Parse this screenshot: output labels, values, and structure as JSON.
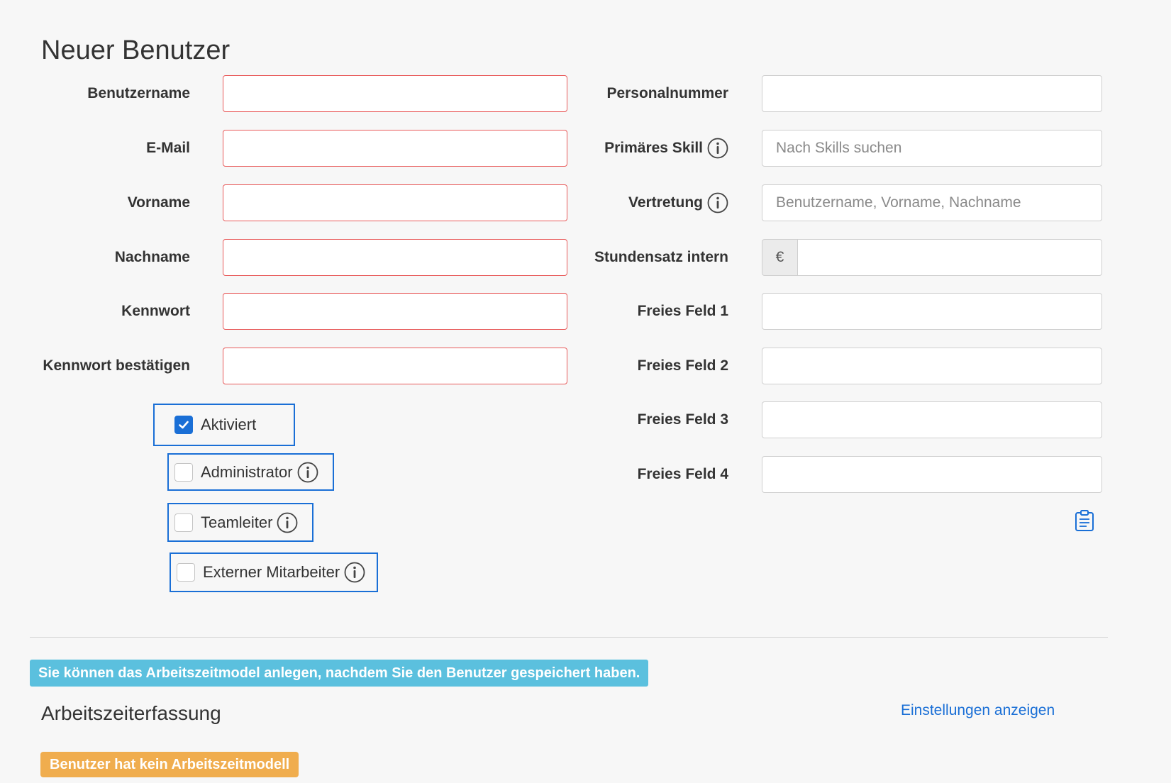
{
  "page": {
    "title": "Neuer Benutzer"
  },
  "left_form": {
    "username": {
      "label": "Benutzername",
      "value": ""
    },
    "email": {
      "label": "E-Mail",
      "value": ""
    },
    "firstname": {
      "label": "Vorname",
      "value": ""
    },
    "lastname": {
      "label": "Nachname",
      "value": ""
    },
    "password": {
      "label": "Kennwort",
      "value": ""
    },
    "password_confirm": {
      "label": "Kennwort bestätigen",
      "value": ""
    }
  },
  "checkboxes": {
    "activated": {
      "label": "Aktiviert",
      "checked": true
    },
    "administrator": {
      "label": "Administrator",
      "checked": false
    },
    "teamlead": {
      "label": "Teamleiter",
      "checked": false
    },
    "external": {
      "label": "Externer Mitarbeiter",
      "checked": false
    }
  },
  "right_form": {
    "personnel_number": {
      "label": "Personalnummer",
      "value": ""
    },
    "primary_skill": {
      "label": "Primäres Skill",
      "placeholder": "Nach Skills suchen"
    },
    "substitute": {
      "label": "Vertretung",
      "placeholder": "Benutzername, Vorname, Nachname"
    },
    "hourly_rate": {
      "label": "Stundensatz intern",
      "currency": "€",
      "value": ""
    },
    "free_field_1": {
      "label": "Freies Feld 1",
      "value": ""
    },
    "free_field_2": {
      "label": "Freies Feld 2",
      "value": ""
    },
    "free_field_3": {
      "label": "Freies Feld 3",
      "value": ""
    },
    "free_field_4": {
      "label": "Freies Feld 4",
      "value": ""
    }
  },
  "icons": {
    "info": "info-icon",
    "clipboard": "clipboard-icon",
    "check": "check-icon"
  },
  "notice": {
    "text": "Sie können das Arbeitszeitmodel anlegen, nachdem Sie den Benutzer gespeichert haben."
  },
  "time_tracking": {
    "title": "Arbeitszeiterfassung",
    "settings_link": "Einstellungen anzeigen",
    "status_badge": "Benutzer hat kein Arbeitszeitmodell"
  },
  "colors": {
    "invalid_border": "#e85a5a",
    "focus_outline": "#1a6fd6",
    "info_banner": "#5bc0de",
    "warning_badge": "#f0ad4e",
    "link": "#1a6fd6"
  }
}
